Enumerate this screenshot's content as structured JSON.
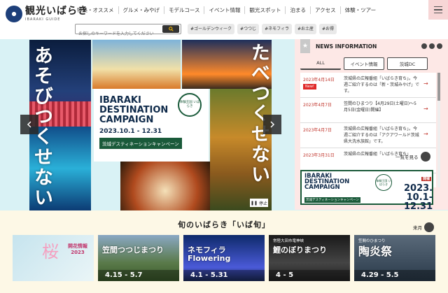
{
  "header": {
    "logo_text": "観光いばらき",
    "logo_sub": "IBARAKI GUIDE",
    "nav": [
      "特集・オススメ",
      "グルメ・みやげ",
      "モデルコース",
      "イベント情報",
      "観光スポット",
      "泊まる",
      "アクセス",
      "体験・ツアー"
    ],
    "search_placeholder": "お探しのキーワードを入力してください",
    "tags": [
      "#ゴールデンウィーク",
      "#つつじ",
      "#ネモフィラ",
      "#お土産",
      "#お得"
    ]
  },
  "hero": {
    "vertical_left": "あそびつくせない",
    "vertical_right": "たべつくせない",
    "campaign_title_1": "IBARAKI",
    "campaign_title_2": "DESTINATION",
    "campaign_title_3": "CAMPAIGN",
    "campaign_date": "2023.10.1 - 12.31",
    "campaign_bar": "茨城デスティネーションキャンペーン",
    "emblem": "体験王国 いばらき",
    "pause_label": "停止"
  },
  "news": {
    "title": "NEWS INFORMATION",
    "tabs": [
      "ALL",
      "イベント情報",
      "茨城DC"
    ],
    "items": [
      {
        "date": "2023年4月14日",
        "new": "New!",
        "text": "茨城県の広報番組「いばらき育ち」。今週ご紹介するのは「新・茨城みやげ」です。"
      },
      {
        "date": "2023年4月7日",
        "new": "",
        "text": "笠間のひまつり【4月29日(土曜日)～5月5日(金曜日)開催】"
      },
      {
        "date": "2023年4月7日",
        "new": "",
        "text": "茨城県の広報番組「いばらき育ち」。今週ご紹介するのは「アクアワールド茨城県大洗水族館」です。"
      },
      {
        "date": "2023年3月31日",
        "new": "",
        "text": "茨城県の広報番組「いばらき育ち」"
      }
    ],
    "more_label": "一覧を見る"
  },
  "banner": {
    "line1": "IBARAKI",
    "line2": "DESTINATION",
    "line3": "CAMPAIGN",
    "bar": "茨城デスティネーションキャンペーン",
    "emblem": "体験王国 いばらき",
    "badge": "開催",
    "year": "2023.",
    "date1": "10.1-",
    "date2": "12.31"
  },
  "season": {
    "title": "旬のいばらき「いば旬」",
    "next_label": "来月",
    "cards": [
      {
        "title": "開花情報 2023",
        "date": "",
        "sub": "桜"
      },
      {
        "title": "笠間つつじまつり",
        "date": "4.15 - 5.7",
        "sub": ""
      },
      {
        "title": "ネモフィラ Flowering",
        "date": "4.1 - 5.31",
        "sub": ""
      },
      {
        "title": "鯉のぼりまつり",
        "date": "4 - 5",
        "sub": "常陸大田市竜神峡"
      },
      {
        "title": "陶炎祭",
        "date": "4.29 - 5.5",
        "sub": "笠間のひまつり"
      }
    ]
  },
  "colors": {
    "accent": "#c0332a",
    "dc_green": "#1a5a3a",
    "hero_bg": "#d9f2f5",
    "news_bg": "#fde8e6"
  }
}
